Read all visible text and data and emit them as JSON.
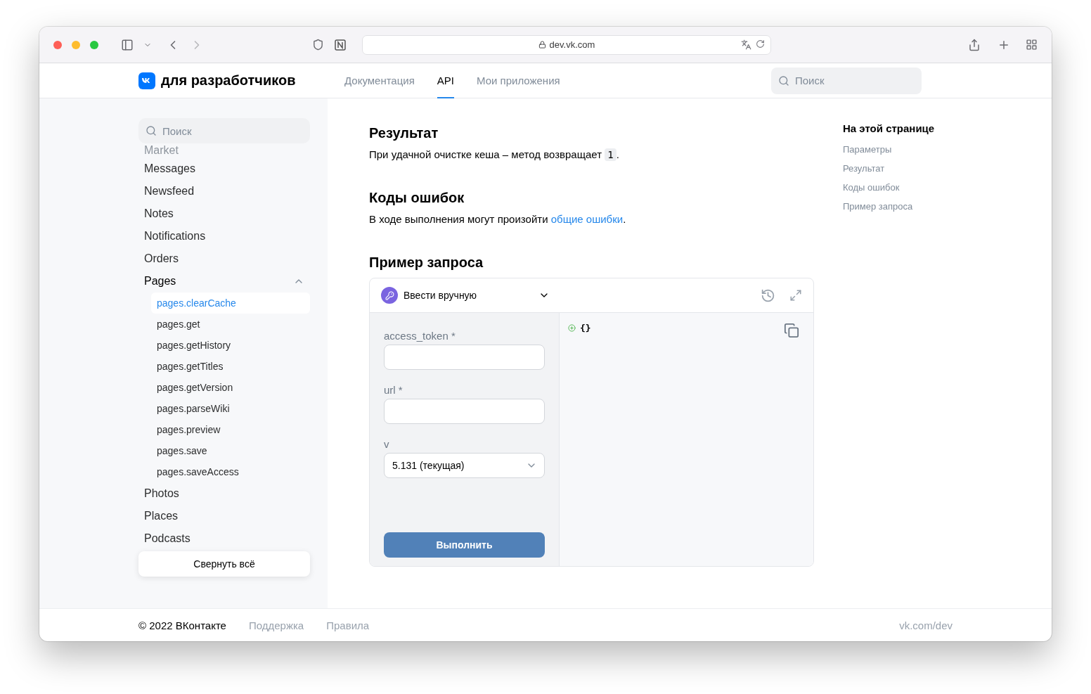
{
  "browser": {
    "address": "dev.vk.com"
  },
  "header": {
    "logo_text": "для разработчиков",
    "nav": [
      {
        "label": "Документация",
        "selected": false
      },
      {
        "label": "API",
        "selected": true
      },
      {
        "label": "Мои приложения",
        "selected": false
      }
    ],
    "search": {
      "placeholder": "Поиск"
    }
  },
  "sidebar": {
    "search": {
      "placeholder": "Поиск"
    },
    "items": [
      {
        "label": "Market",
        "kind": "faded",
        "expanded": false
      },
      {
        "label": "Messages",
        "kind": "normal",
        "expanded": false
      },
      {
        "label": "Newsfeed",
        "kind": "normal",
        "expanded": false
      },
      {
        "label": "Notes",
        "kind": "normal",
        "expanded": false
      },
      {
        "label": "Notifications",
        "kind": "normal",
        "expanded": false
      },
      {
        "label": "Orders",
        "kind": "normal",
        "expanded": false
      },
      {
        "label": "Pages",
        "kind": "normal",
        "expanded": true,
        "children": [
          {
            "label": "pages.clearCache",
            "selected": true
          },
          {
            "label": "pages.get",
            "selected": false
          },
          {
            "label": "pages.getHistory",
            "selected": false
          },
          {
            "label": "pages.getTitles",
            "selected": false
          },
          {
            "label": "pages.getVersion",
            "selected": false
          },
          {
            "label": "pages.parseWiki",
            "selected": false
          },
          {
            "label": "pages.preview",
            "selected": false
          },
          {
            "label": "pages.save",
            "selected": false
          },
          {
            "label": "pages.saveAccess",
            "selected": false
          }
        ]
      },
      {
        "label": "Photos",
        "kind": "normal",
        "expanded": false
      },
      {
        "label": "Places",
        "kind": "normal",
        "expanded": false
      },
      {
        "label": "Podcasts",
        "kind": "normal",
        "expanded": false
      }
    ],
    "collapse_button": "Свернуть всё"
  },
  "content": {
    "sections": [
      {
        "title": "Результат",
        "text": "При удачной очистке кеша – метод возвращает ",
        "code": "1",
        "after": "."
      },
      {
        "title": "Коды ошибок",
        "text": "В ходе выполнения могут произойти ",
        "link": "общие ошибки",
        "after": "."
      }
    ],
    "request": {
      "title": "Пример запроса",
      "mode": "Ввести вручную",
      "fields": [
        {
          "label": "access_token *",
          "kind": "input"
        },
        {
          "label": "url *",
          "kind": "input"
        },
        {
          "label": "v",
          "kind": "select",
          "value": "5.131 (текущая)"
        }
      ],
      "submit": "Выполнить",
      "output": "{}"
    }
  },
  "toc": {
    "title": "На этой странице",
    "items": [
      "Параметры",
      "Результат",
      "Коды ошибок",
      "Пример запроса"
    ]
  },
  "footer": {
    "copyright": "© 2022 ВКонтакте",
    "links": [
      "Поддержка",
      "Правила"
    ],
    "right": "vk.com/dev"
  }
}
